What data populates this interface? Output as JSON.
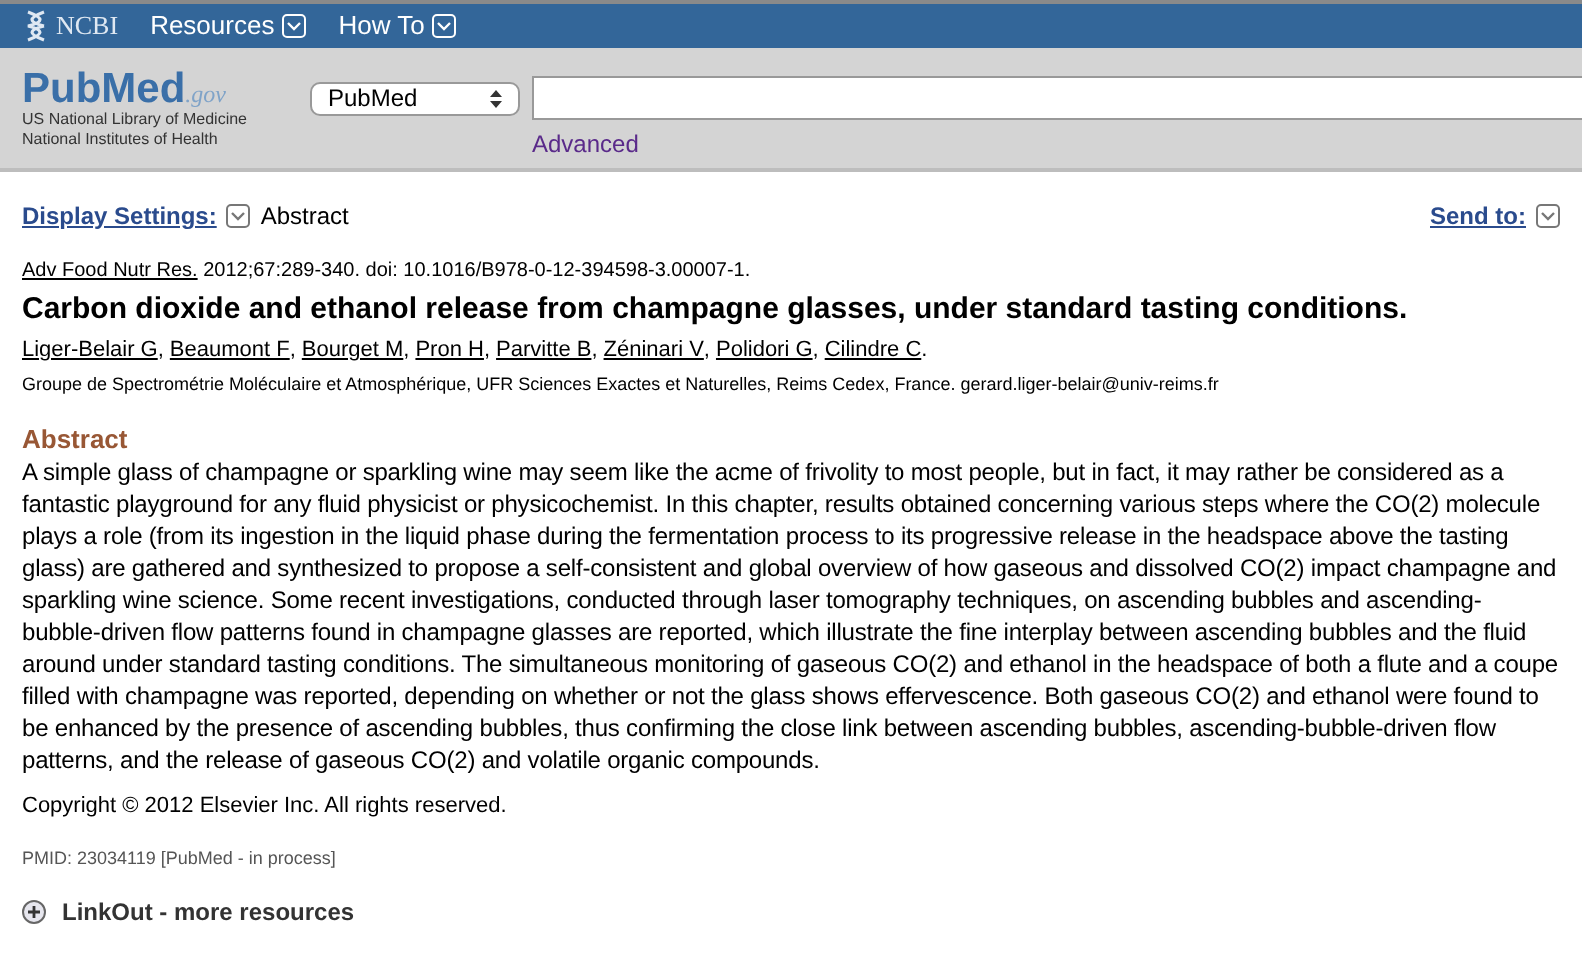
{
  "top_bar": {
    "logo": "NCBI",
    "menus": [
      {
        "label": "Resources"
      },
      {
        "label": "How To"
      }
    ]
  },
  "header": {
    "logo": {
      "pub": "Pub",
      "med": "Med",
      "gov": ".gov"
    },
    "org_lines": [
      "US National Library of Medicine",
      "National Institutes of Health"
    ],
    "database": "PubMed",
    "advanced": "Advanced"
  },
  "display_bar": {
    "settings_label": "Display Settings:",
    "format": "Abstract",
    "send_to": "Send to:"
  },
  "citation": {
    "journal": "Adv Food Nutr Res.",
    "details": "2012;67:289-340. doi: 10.1016/B978-0-12-394598-3.00007-1."
  },
  "title": "Carbon dioxide and ethanol release from champagne glasses, under standard tasting conditions.",
  "authors": [
    {
      "name": "Liger-Belair G",
      "after": ","
    },
    {
      "name": "Beaumont F",
      "after": ","
    },
    {
      "name": "Bourget M",
      "after": ","
    },
    {
      "name": "Pron H",
      "after": ","
    },
    {
      "name": "Parvitte B",
      "after": ","
    },
    {
      "name": "Zéninari V",
      "after": ","
    },
    {
      "name": "Polidori G",
      "after": ","
    },
    {
      "name": "Cilindre C",
      "after": "."
    }
  ],
  "affiliation": "Groupe de Spectrométrie Moléculaire et Atmosphérique, UFR Sciences Exactes et Naturelles, Reims Cedex, France. gerard.liger-belair@univ-reims.fr",
  "abstract": {
    "heading": "Abstract",
    "text": "A simple glass of champagne or sparkling wine may seem like the acme of frivolity to most people, but in fact, it may rather be considered as a fantastic playground for any fluid physicist or physicochemist. In this chapter, results obtained concerning various steps where the CO(2) molecule plays a role (from its ingestion in the liquid phase during the fermentation process to its progressive release in the headspace above the tasting glass) are gathered and synthesized to propose a self-consistent and global overview of how gaseous and dissolved CO(2) impact champagne and sparkling wine science. Some recent investigations, conducted through laser tomography techniques, on ascending bubbles and ascending-bubble-driven flow patterns found in champagne glasses are reported, which illustrate the fine interplay between ascending bubbles and the fluid around under standard tasting conditions. The simultaneous monitoring of gaseous CO(2) and ethanol in the headspace of both a flute and a coupe filled with champagne was reported, depending on whether or not the glass shows effervescence. Both gaseous CO(2) and ethanol were found to be enhanced by the presence of ascending bubbles, thus confirming the close link between ascending bubbles, ascending-bubble-driven flow patterns, and the release of gaseous CO(2) and volatile organic compounds.",
    "copyright": "Copyright © 2012 Elsevier Inc. All rights reserved."
  },
  "pmid": "PMID: 23034119 [PubMed - in process]",
  "linkout": {
    "label": "LinkOut - more resources",
    "expanded": false
  }
}
